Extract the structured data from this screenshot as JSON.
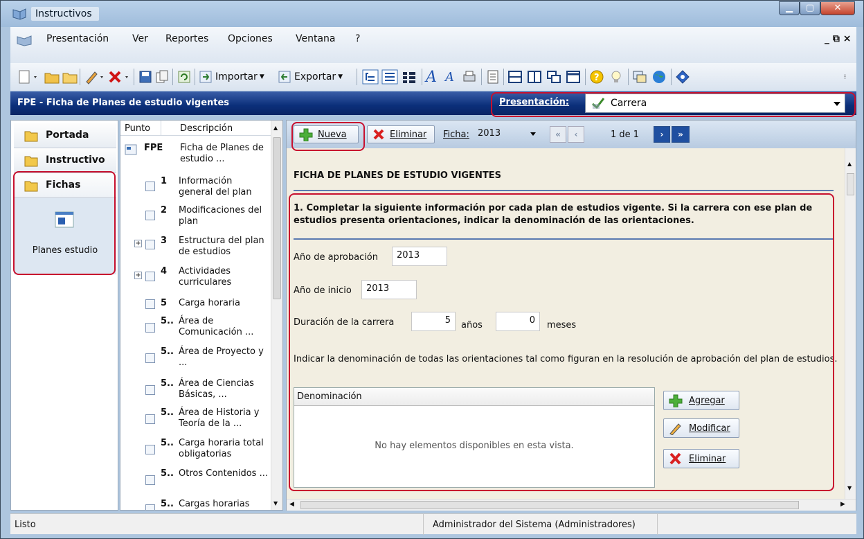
{
  "window": {
    "title": "Instructivos"
  },
  "menu": {
    "items": [
      "Presentación",
      "Ver",
      "Reportes",
      "Opciones",
      "Ventana",
      "?"
    ],
    "mdi_controls": "_ ⧉ ×"
  },
  "toolbar": {
    "import_label": "Importar",
    "export_label": "Exportar"
  },
  "header": {
    "title": "FPE - Ficha de Planes de estudio vigentes",
    "presentation_label": "Presentación:",
    "presentation_value": "Carrera"
  },
  "leftnav": {
    "items": [
      "Portada",
      "Instructivo",
      "Fichas"
    ],
    "sub_item": "Planes estudio"
  },
  "tree": {
    "col_punto": "Punto",
    "col_desc": "Descripción",
    "rows": [
      {
        "num": "FPE",
        "desc": "Ficha de Planes de estudio ..."
      },
      {
        "num": "1",
        "desc": "Información general del plan"
      },
      {
        "num": "2",
        "desc": "Modificaciones del plan"
      },
      {
        "num": "3",
        "desc": "Estructura del plan de estudios"
      },
      {
        "num": "4",
        "desc": "Actividades curriculares"
      },
      {
        "num": "5",
        "desc": "Carga horaria"
      },
      {
        "num": "5..",
        "desc": "Área de Comunicación ..."
      },
      {
        "num": "5..",
        "desc": "Área de Proyecto y ..."
      },
      {
        "num": "5..",
        "desc": "Área de Ciencias Básicas, ..."
      },
      {
        "num": "5..",
        "desc": "Área de Historia y Teoría de la ..."
      },
      {
        "num": "5..",
        "desc": "Carga horaria total obligatorias"
      },
      {
        "num": "5..",
        "desc": "Otros Contenidos ..."
      },
      {
        "num": "5..",
        "desc": "Cargas horarias"
      }
    ]
  },
  "mainbar": {
    "new_label": "Nueva",
    "delete_label": "Eliminar",
    "ficha_label": "Ficha:",
    "ficha_value": "2013",
    "pager": "1 de 1"
  },
  "form": {
    "section_title": "FICHA DE PLANES DE ESTUDIO VIGENTES",
    "question": "1. Completar la siguiente información por cada plan de estudios vigente. Si la carrera con ese plan de estudios presenta orientaciones, indicar la denominación de las orientaciones.",
    "aprobacion_label": "Año de aprobación",
    "aprobacion_value": "2013",
    "inicio_label": "Año de inicio",
    "inicio_value": "2013",
    "duracion_label": "Duración de la carrera",
    "duracion_anios": "5",
    "anios_label": "años",
    "duracion_meses": "0",
    "meses_label": "meses",
    "orient_text": "Indicar la denominación de todas las orientaciones tal como figuran en la resolución de aprobación del plan de estudios.",
    "grid_header": "Denominación",
    "grid_empty": "No hay elementos disponibles en esta vista.",
    "add_label": "Agregar",
    "edit_label": "Modificar",
    "remove_label": "Eliminar"
  },
  "status": {
    "left": "Listo",
    "user": "Administrador del Sistema (Administradores)"
  }
}
